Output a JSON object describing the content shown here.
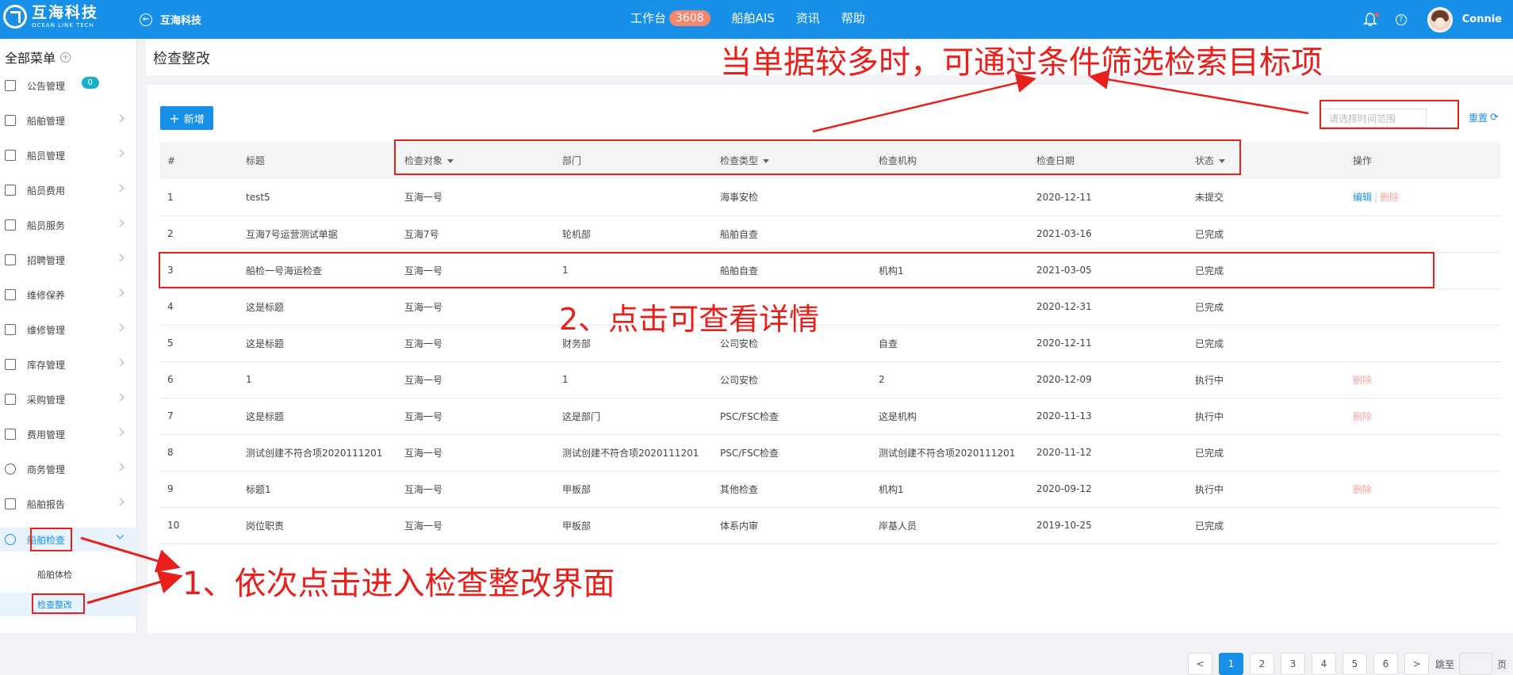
{
  "topbar": {
    "logo_main": "互海科技",
    "logo_sub": "OCEAN LINK TECH",
    "back_label": "互海科技",
    "nav": [
      {
        "label": "工作台",
        "badge": "3608"
      },
      {
        "label": "船舶AIS"
      },
      {
        "label": "资讯"
      },
      {
        "label": "帮助"
      }
    ],
    "help_glyph": "?",
    "username": "Connie"
  },
  "sidebar": {
    "title": "全部菜单",
    "items": [
      {
        "label": "公告管理",
        "badge": "0"
      },
      {
        "label": "船舶管理"
      },
      {
        "label": "船员管理"
      },
      {
        "label": "船员费用"
      },
      {
        "label": "船员服务"
      },
      {
        "label": "招聘管理"
      },
      {
        "label": "维修保养"
      },
      {
        "label": "维修管理"
      },
      {
        "label": "库存管理"
      },
      {
        "label": "采购管理"
      },
      {
        "label": "费用管理"
      },
      {
        "label": "商务管理"
      },
      {
        "label": "船舶报告"
      },
      {
        "label": "船舶检查"
      }
    ],
    "subitems": [
      "船舶体检",
      "检查整改"
    ]
  },
  "page": {
    "title": "检查整改",
    "new_button": "新增",
    "date_placeholder": "请选择时间范围",
    "reset_label": "重置"
  },
  "table": {
    "headers": [
      "#",
      "标题",
      "检查对象",
      "部门",
      "检查类型",
      "检查机构",
      "检查日期",
      "状态",
      "操作"
    ],
    "rows": [
      {
        "no": "1",
        "title": "test5",
        "target": "互海一号",
        "dept": "",
        "type": "海事安检",
        "org": "",
        "date": "2020-12-11",
        "status": "未提交",
        "edit": "编辑",
        "del": "删除"
      },
      {
        "no": "2",
        "title": "互海7号运营测试单据",
        "target": "互海7号",
        "dept": "轮机部",
        "type": "船舶自查",
        "org": "",
        "date": "2021-03-16",
        "status": "已完成",
        "edit": "",
        "del": ""
      },
      {
        "no": "3",
        "title": "船检一号海运检查",
        "target": "互海一号",
        "dept": "1",
        "type": "船舶自查",
        "org": "机构1",
        "date": "2021-03-05",
        "status": "已完成",
        "edit": "",
        "del": ""
      },
      {
        "no": "4",
        "title": "这是标题",
        "target": "互海一号",
        "dept": "",
        "type": "",
        "org": "",
        "date": "2020-12-31",
        "status": "已完成",
        "edit": "",
        "del": ""
      },
      {
        "no": "5",
        "title": "这是标题",
        "target": "互海一号",
        "dept": "财务部",
        "type": "公司安检",
        "org": "自查",
        "date": "2020-12-11",
        "status": "已完成",
        "edit": "",
        "del": ""
      },
      {
        "no": "6",
        "title": "1",
        "target": "互海一号",
        "dept": "1",
        "type": "公司安检",
        "org": "2",
        "date": "2020-12-09",
        "status": "执行中",
        "edit": "",
        "del": "删除"
      },
      {
        "no": "7",
        "title": "这是标题",
        "target": "互海一号",
        "dept": "这是部门",
        "type": "PSC/FSC检查",
        "org": "这是机构",
        "date": "2020-11-13",
        "status": "执行中",
        "edit": "",
        "del": "删除"
      },
      {
        "no": "8",
        "title": "测试创建不符合项2020111201",
        "target": "互海一号",
        "dept": "测试创建不符合项2020111201",
        "type": "PSC/FSC检查",
        "org": "测试创建不符合项2020111201",
        "date": "2020-11-12",
        "status": "已完成",
        "edit": "",
        "del": ""
      },
      {
        "no": "9",
        "title": "标题1",
        "target": "互海一号",
        "dept": "甲板部",
        "type": "其他检查",
        "org": "机构1",
        "date": "2020-09-12",
        "status": "执行中",
        "edit": "",
        "del": "删除"
      },
      {
        "no": "10",
        "title": "岗位职责",
        "target": "互海一号",
        "dept": "甲板部",
        "type": "体系内审",
        "org": "岸基人员",
        "date": "2019-10-25",
        "status": "已完成",
        "edit": "",
        "del": ""
      }
    ]
  },
  "pager": {
    "prev": "<",
    "pages": [
      "1",
      "2",
      "3",
      "4",
      "5",
      "6"
    ],
    "next": ">",
    "jump_prefix": "跳至",
    "jump_suffix": "页"
  },
  "annotations": {
    "filter_note": "当单据较多时，可通过条件筛选检索目标项",
    "detail_note": "2、点击可查看详情",
    "enter_note": "1、依次点击进入检查整改界面"
  },
  "colors": {
    "primary": "#1890e8",
    "annotation": "#e8201c",
    "delete": "#f4a3a3"
  }
}
